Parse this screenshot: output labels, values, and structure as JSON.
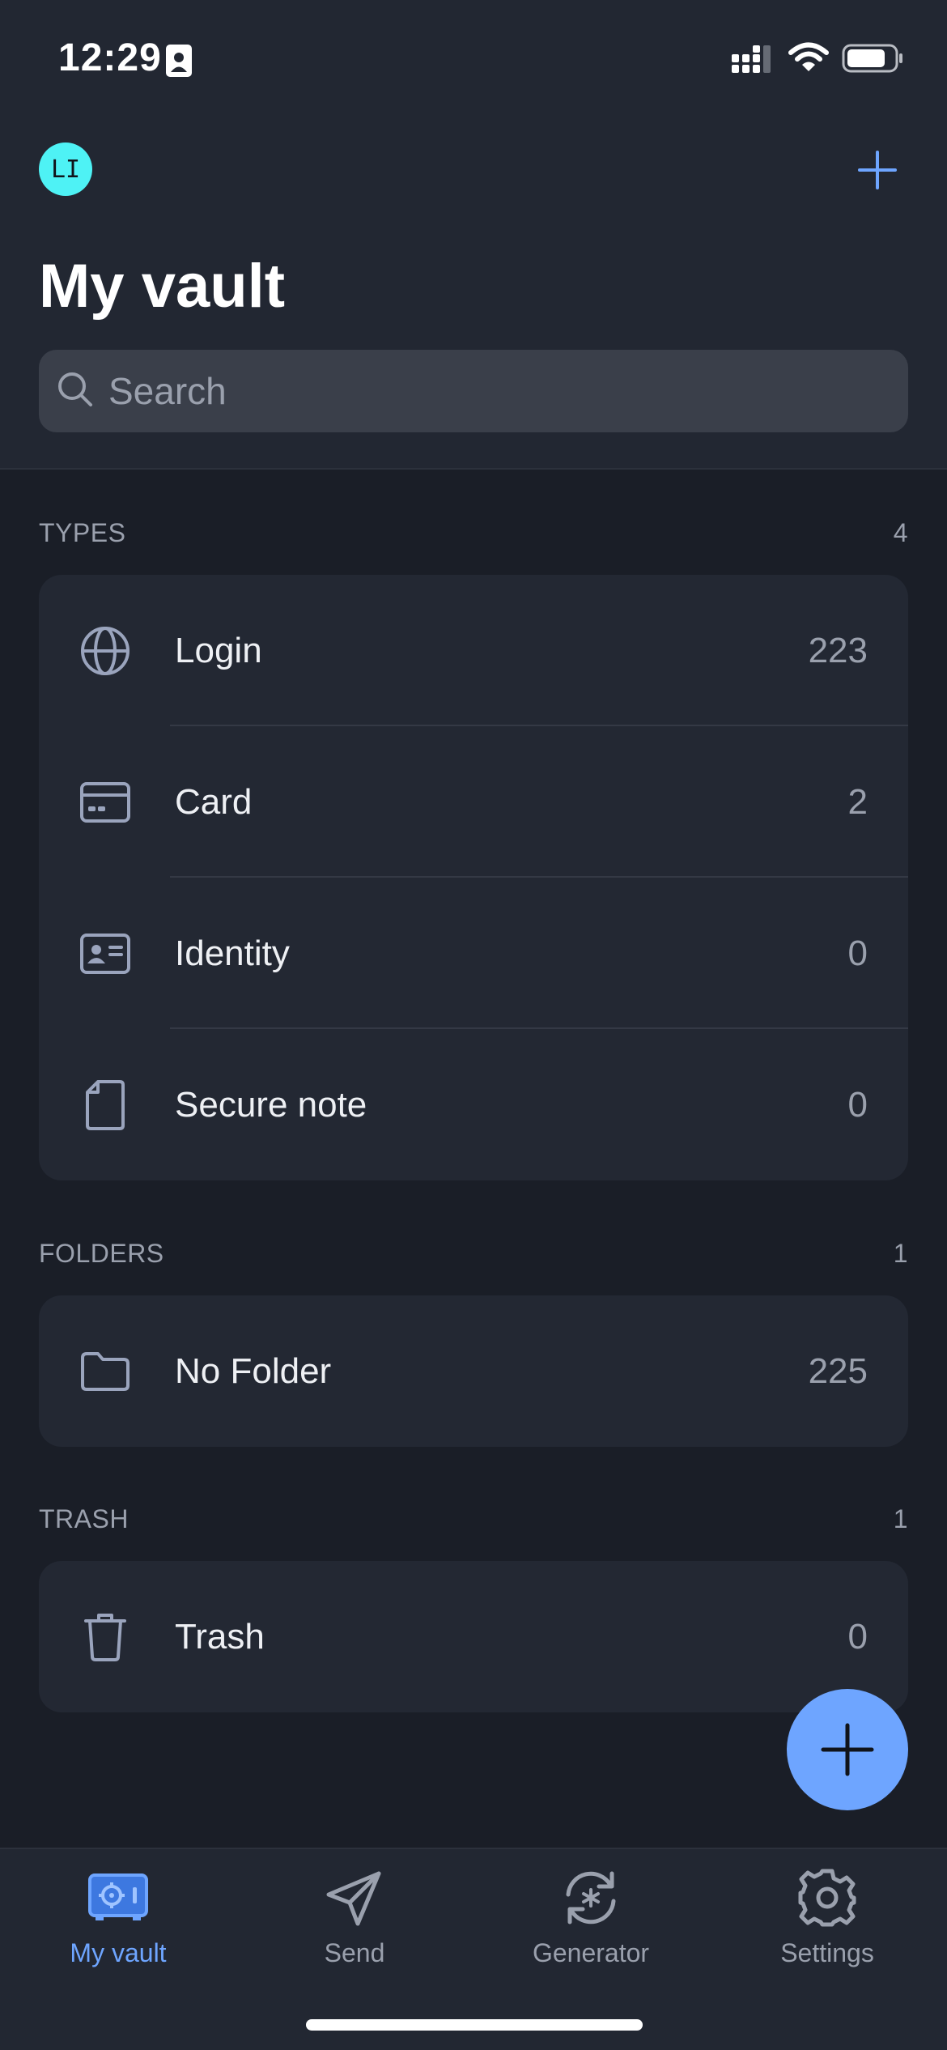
{
  "status_bar": {
    "time": "12:29"
  },
  "header": {
    "avatar_initials": "LI",
    "title": "My vault",
    "search_placeholder": "Search"
  },
  "sections": {
    "types": {
      "label": "TYPES",
      "count": "4",
      "items": [
        {
          "label": "Login",
          "count": "223",
          "icon": "globe-icon"
        },
        {
          "label": "Card",
          "count": "2",
          "icon": "card-icon"
        },
        {
          "label": "Identity",
          "count": "0",
          "icon": "identity-icon"
        },
        {
          "label": "Secure note",
          "count": "0",
          "icon": "note-icon"
        }
      ]
    },
    "folders": {
      "label": "FOLDERS",
      "count": "1",
      "items": [
        {
          "label": "No Folder",
          "count": "225",
          "icon": "folder-icon"
        }
      ]
    },
    "trash": {
      "label": "TRASH",
      "count": "1",
      "items": [
        {
          "label": "Trash",
          "count": "0",
          "icon": "trash-icon"
        }
      ]
    }
  },
  "tabbar": {
    "tabs": [
      {
        "label": "My vault",
        "icon": "vault-icon",
        "active": true
      },
      {
        "label": "Send",
        "icon": "send-icon",
        "active": false
      },
      {
        "label": "Generator",
        "icon": "generator-icon",
        "active": false
      },
      {
        "label": "Settings",
        "icon": "gear-icon",
        "active": false
      }
    ]
  },
  "colors": {
    "accent": "#6ea5ff",
    "avatar": "#4ef2f5",
    "background": "#1a1e27",
    "card": "#232833"
  }
}
